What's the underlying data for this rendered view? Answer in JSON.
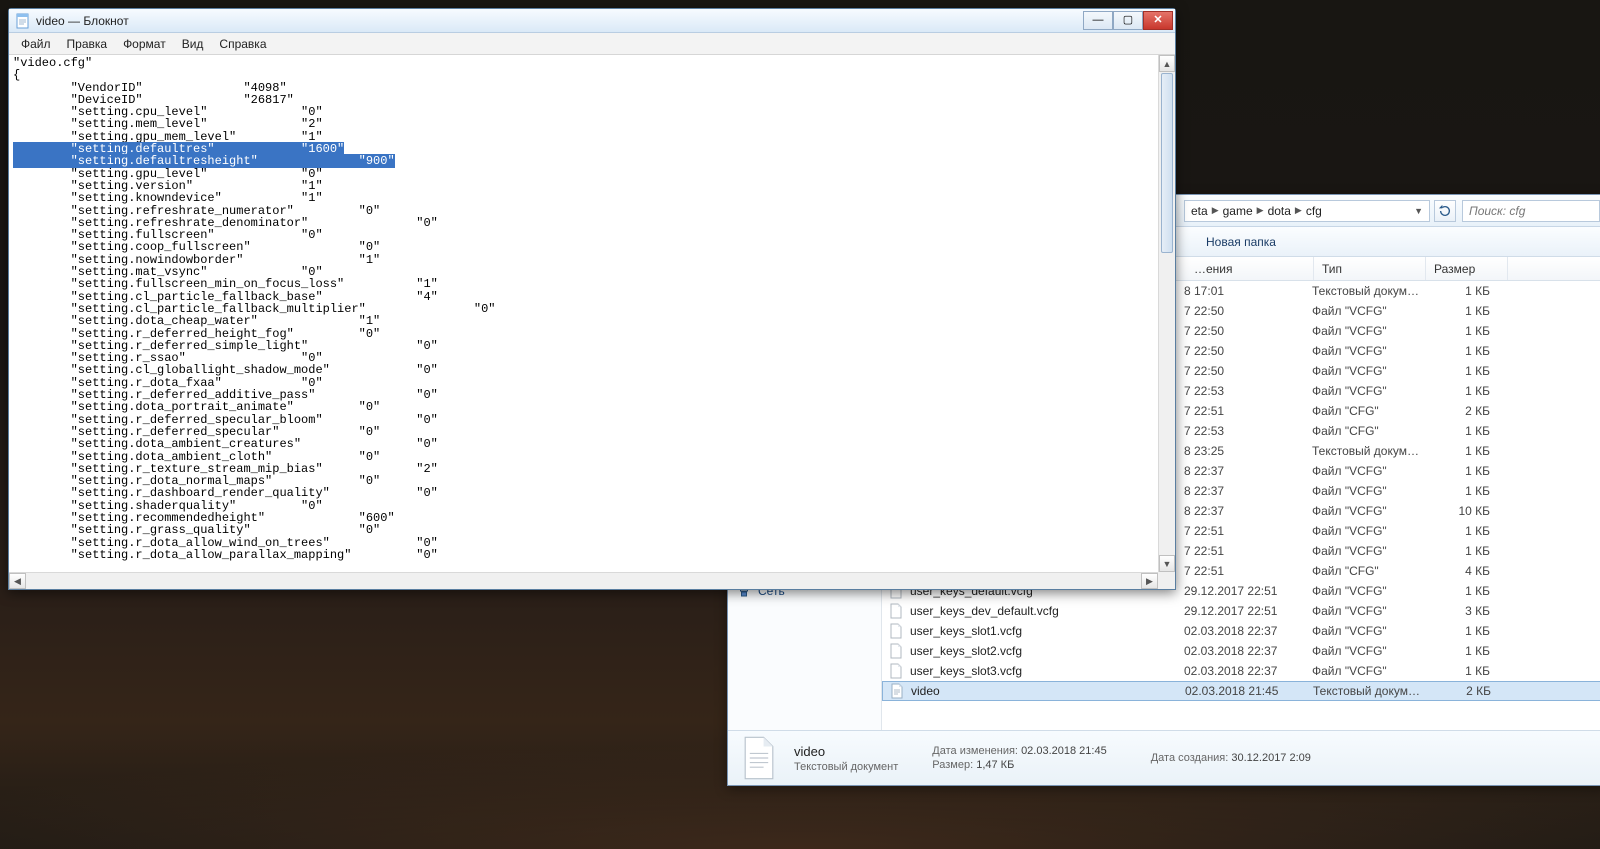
{
  "notepad": {
    "title": "video — Блокнот",
    "menu": [
      "Файл",
      "Правка",
      "Формат",
      "Вид",
      "Справка"
    ],
    "window_buttons": {
      "min": "—",
      "max": "▢",
      "close": "✕"
    },
    "lines_pre": [
      "\"video.cfg\"",
      "{",
      "        \"VendorID\"              \"4098\"",
      "        \"DeviceID\"              \"26817\"",
      "        \"setting.cpu_level\"             \"0\"",
      "        \"setting.mem_level\"             \"2\"",
      "        \"setting.gpu_mem_level\"         \"1\""
    ],
    "sel1": "        \"setting.defaultres\"            \"1600\"",
    "sel2": "        \"setting.defaultresheight\"              \"900\"",
    "lines_post": [
      "        \"setting.gpu_level\"             \"0\"",
      "        \"setting.version\"               \"1\"",
      "        \"setting.knowndevice\"           \"1\"",
      "        \"setting.refreshrate_numerator\"         \"0\"",
      "        \"setting.refreshrate_denominator\"               \"0\"",
      "        \"setting.fullscreen\"            \"0\"",
      "        \"setting.coop_fullscreen\"               \"0\"",
      "        \"setting.nowindowborder\"                \"1\"",
      "        \"setting.mat_vsync\"             \"0\"",
      "        \"setting.fullscreen_min_on_focus_loss\"          \"1\"",
      "        \"setting.cl_particle_fallback_base\"             \"4\"",
      "        \"setting.cl_particle_fallback_multiplier\"               \"0\"",
      "        \"setting.dota_cheap_water\"              \"1\"",
      "        \"setting.r_deferred_height_fog\"         \"0\"",
      "        \"setting.r_deferred_simple_light\"               \"0\"",
      "        \"setting.r_ssao\"                \"0\"",
      "        \"setting.cl_globallight_shadow_mode\"            \"0\"",
      "        \"setting.r_dota_fxaa\"           \"0\"",
      "        \"setting.r_deferred_additive_pass\"              \"0\"",
      "        \"setting.dota_portrait_animate\"         \"0\"",
      "        \"setting.r_deferred_specular_bloom\"             \"0\"",
      "        \"setting.r_deferred_specular\"           \"0\"",
      "        \"setting.dota_ambient_creatures\"                \"0\"",
      "        \"setting.dota_ambient_cloth\"            \"0\"",
      "        \"setting.r_texture_stream_mip_bias\"             \"2\"",
      "        \"setting.r_dota_normal_maps\"            \"0\"",
      "        \"setting.r_dashboard_render_quality\"            \"0\"",
      "        \"setting.shaderquality\"         \"0\"",
      "        \"setting.recommendedheight\"             \"600\"",
      "        \"setting.r_grass_quality\"               \"0\"",
      "        \"setting.r_dota_allow_wind_on_trees\"            \"0\"",
      "        \"setting.r_dota_allow_parallax_mapping\"         \"0\""
    ]
  },
  "explorer": {
    "crumb": [
      "eta",
      "game",
      "dota",
      "cfg"
    ],
    "search_placeholder": "Поиск: cfg",
    "toolbar_newfolder": "Новая папка",
    "cols": {
      "date": "…ения",
      "type": "Тип",
      "size": "Размер"
    },
    "side_network": "Сеть",
    "rows": [
      {
        "date": "8 17:01",
        "type": "Текстовый докум…",
        "size": "1 КБ",
        "kind": "txt"
      },
      {
        "date": "7 22:50",
        "type": "Файл \"VCFG\"",
        "size": "1 КБ",
        "kind": "vcfg"
      },
      {
        "date": "7 22:50",
        "type": "Файл \"VCFG\"",
        "size": "1 КБ",
        "kind": "vcfg"
      },
      {
        "date": "7 22:50",
        "type": "Файл \"VCFG\"",
        "size": "1 КБ",
        "kind": "vcfg"
      },
      {
        "date": "7 22:50",
        "type": "Файл \"VCFG\"",
        "size": "1 КБ",
        "kind": "vcfg"
      },
      {
        "date": "7 22:53",
        "type": "Файл \"VCFG\"",
        "size": "1 КБ",
        "kind": "vcfg"
      },
      {
        "date": "7 22:51",
        "type": "Файл \"CFG\"",
        "size": "2 КБ",
        "kind": "cfg"
      },
      {
        "date": "7 22:53",
        "type": "Файл \"CFG\"",
        "size": "1 КБ",
        "kind": "cfg"
      },
      {
        "date": "8 23:25",
        "type": "Текстовый докум…",
        "size": "1 КБ",
        "kind": "txt"
      },
      {
        "date": "8 22:37",
        "type": "Файл \"VCFG\"",
        "size": "1 КБ",
        "kind": "vcfg"
      },
      {
        "date": "8 22:37",
        "type": "Файл \"VCFG\"",
        "size": "1 КБ",
        "kind": "vcfg"
      },
      {
        "date": "8 22:37",
        "type": "Файл \"VCFG\"",
        "size": "10 КБ",
        "kind": "vcfg"
      },
      {
        "date": "7 22:51",
        "type": "Файл \"VCFG\"",
        "size": "1 КБ",
        "kind": "vcfg"
      },
      {
        "date": "7 22:51",
        "type": "Файл \"VCFG\"",
        "size": "1 КБ",
        "kind": "vcfg"
      },
      {
        "date": "7 22:51",
        "type": "Файл \"CFG\"",
        "size": "4 КБ",
        "kind": "cfg"
      }
    ],
    "rows_full": [
      {
        "name": "user_keys_default.vcfg",
        "date": "29.12.2017 22:51",
        "type": "Файл \"VCFG\"",
        "size": "1 КБ",
        "kind": "vcfg"
      },
      {
        "name": "user_keys_dev_default.vcfg",
        "date": "29.12.2017 22:51",
        "type": "Файл \"VCFG\"",
        "size": "3 КБ",
        "kind": "vcfg"
      },
      {
        "name": "user_keys_slot1.vcfg",
        "date": "02.03.2018 22:37",
        "type": "Файл \"VCFG\"",
        "size": "1 КБ",
        "kind": "vcfg"
      },
      {
        "name": "user_keys_slot2.vcfg",
        "date": "02.03.2018 22:37",
        "type": "Файл \"VCFG\"",
        "size": "1 КБ",
        "kind": "vcfg"
      },
      {
        "name": "user_keys_slot3.vcfg",
        "date": "02.03.2018 22:37",
        "type": "Файл \"VCFG\"",
        "size": "1 КБ",
        "kind": "vcfg"
      },
      {
        "name": "video",
        "date": "02.03.2018 21:45",
        "type": "Текстовый докум…",
        "size": "2 КБ",
        "kind": "txt",
        "selected": true
      }
    ],
    "details": {
      "name": "video",
      "type": "Текстовый документ",
      "mod_label": "Дата изменения:",
      "mod_val": "02.03.2018 21:45",
      "size_label": "Размер:",
      "size_val": "1,47 КБ",
      "created_label": "Дата создания:",
      "created_val": "30.12.2017 2:09"
    }
  }
}
